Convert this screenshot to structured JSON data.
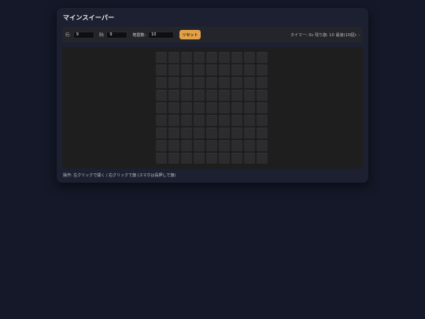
{
  "app": {
    "title": "マインスイーパー"
  },
  "controls": {
    "rows_label": "行:",
    "rows_value": "9",
    "cols_label": "列:",
    "cols_value": "9",
    "mines_label": "地雷数:",
    "mines_value": "10",
    "reset_label": "リセット"
  },
  "status": {
    "timer": "タイマー: 0s",
    "remaining": "残り旗: 10",
    "best": "最速(10個): -"
  },
  "board": {
    "rows": 9,
    "cols": 9
  },
  "footer": {
    "help_text": "操作: 左クリックで開く / 右クリックで旗 (スマホは長押しで旗)"
  },
  "colors": {
    "background": "#141828",
    "panel": "#1c2030",
    "accent": "#e3a14a",
    "cell": "#2c2c2e"
  }
}
